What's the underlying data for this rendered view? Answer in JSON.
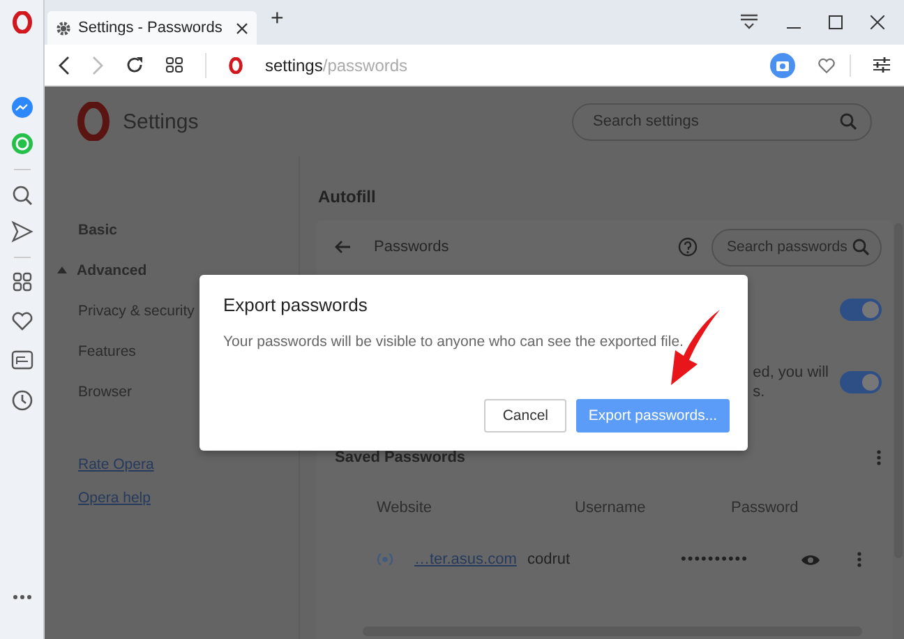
{
  "window": {
    "tabs": [
      {
        "title": "Settings - Passwords",
        "selected": true
      }
    ],
    "new_tab": "+"
  },
  "address_bar": {
    "host": "settings",
    "path": "/passwords"
  },
  "settings_header": {
    "title": "Settings",
    "search": {
      "placeholder": "Search settings"
    }
  },
  "nav": {
    "items": [
      {
        "label": "Basic",
        "kind": "section"
      },
      {
        "label": "Advanced",
        "kind": "group",
        "expanded": true
      },
      {
        "label": "Privacy & security",
        "kind": "item"
      },
      {
        "label": "Features",
        "kind": "item"
      },
      {
        "label": "Browser",
        "kind": "item"
      }
    ],
    "links": [
      "Rate Opera",
      "Opera help"
    ]
  },
  "main": {
    "section_title": "Autofill",
    "panel_title": "Passwords",
    "search": {
      "placeholder": "Search passwords"
    },
    "toggles": [
      {
        "on": true
      },
      {
        "on": true,
        "text": [
          "ed, you will",
          "s."
        ]
      }
    ],
    "saved": {
      "title": "Saved Passwords",
      "columns": [
        "Website",
        "Username",
        "Password"
      ],
      "rows": [
        {
          "website": "…ter.asus.com",
          "username": "codrut",
          "password": "••••••••••"
        }
      ]
    }
  },
  "dialog": {
    "title": "Export passwords",
    "message": "Your passwords will be visible to anyone who can see the exported file.",
    "buttons": [
      {
        "label": "Cancel",
        "kind": "secondary"
      },
      {
        "label": "Export passwords...",
        "kind": "primary"
      }
    ]
  }
}
